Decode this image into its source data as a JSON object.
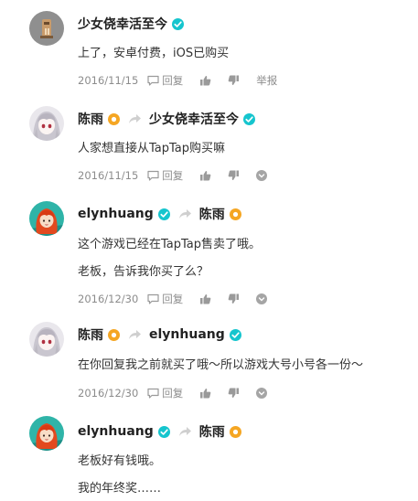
{
  "comments": [
    {
      "author": "少女侥幸活至今",
      "author_badge": "blue",
      "reply_to": null,
      "lines": [
        "上了，安卓付费，iOS已购买"
      ],
      "date": "2016/11/15",
      "reply_label": "回复",
      "action_label": "举报"
    },
    {
      "author": "陈雨",
      "author_badge": "orange",
      "reply_to": "少女侥幸活至今",
      "reply_to_badge": "blue",
      "lines": [
        "人家想直接从TapTap购买嘛"
      ],
      "date": "2016/11/15",
      "reply_label": "回复",
      "action_label": ""
    },
    {
      "author": "elynhuang",
      "author_badge": "blue",
      "reply_to": "陈雨",
      "reply_to_badge": "orange",
      "lines": [
        "这个游戏已经在TapTap售卖了哦。",
        "老板，告诉我你买了么？"
      ],
      "date": "2016/12/30",
      "reply_label": "回复",
      "action_label": ""
    },
    {
      "author": "陈雨",
      "author_badge": "orange",
      "reply_to": "elynhuang",
      "reply_to_badge": "blue",
      "lines": [
        "在你回复我之前就买了哦～所以游戏大号小号各一份～"
      ],
      "date": "2016/12/30",
      "reply_label": "回复",
      "action_label": ""
    },
    {
      "author": "elynhuang",
      "author_badge": "blue",
      "reply_to": "陈雨",
      "reply_to_badge": "orange",
      "lines": [
        "老板好有钱哦。",
        "我的年终奖……"
      ],
      "date": "",
      "reply_label": "",
      "action_label": ""
    }
  ],
  "colors": {
    "verified_blue": "#15c5ce",
    "badge_orange": "#f5a623",
    "meta_gray": "#8c8c8c"
  },
  "icons": [
    "verified-icon",
    "star-badge-icon",
    "reply-arrow-icon",
    "comment-icon",
    "thumbs-up-icon",
    "thumbs-down-icon",
    "more-icon"
  ]
}
